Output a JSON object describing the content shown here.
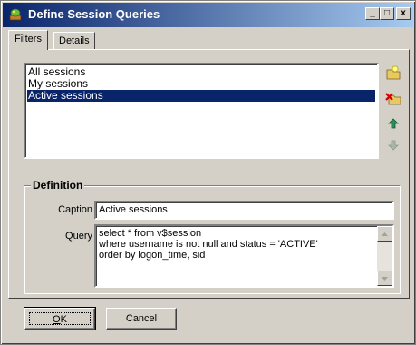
{
  "window": {
    "title": "Define Session Queries",
    "minimize": "_",
    "maximize": "□",
    "close": "x"
  },
  "tabs": [
    {
      "label": "Filters",
      "active": true
    },
    {
      "label": "Details",
      "active": false
    }
  ],
  "sessions": {
    "items": [
      "All sessions",
      "My sessions",
      "Active sessions"
    ],
    "selected_index": 2,
    "buttons": [
      "new-query-icon",
      "delete-query-icon",
      "move-up-icon",
      "move-down-icon"
    ]
  },
  "definition": {
    "title": "Definition",
    "caption_label": "Caption",
    "caption_value": "Active sessions",
    "query_label": "Query",
    "query_lines": [
      "select * from v$session",
      "where username is not null and status = 'ACTIVE'",
      "order by logon_time, sid"
    ]
  },
  "buttons": {
    "ok": "OK",
    "cancel": "Cancel"
  },
  "colors": {
    "titlebar_start": "#0a246a",
    "titlebar_end": "#a6caf0",
    "face": "#d4d0c8",
    "selection": "#0a246a"
  }
}
